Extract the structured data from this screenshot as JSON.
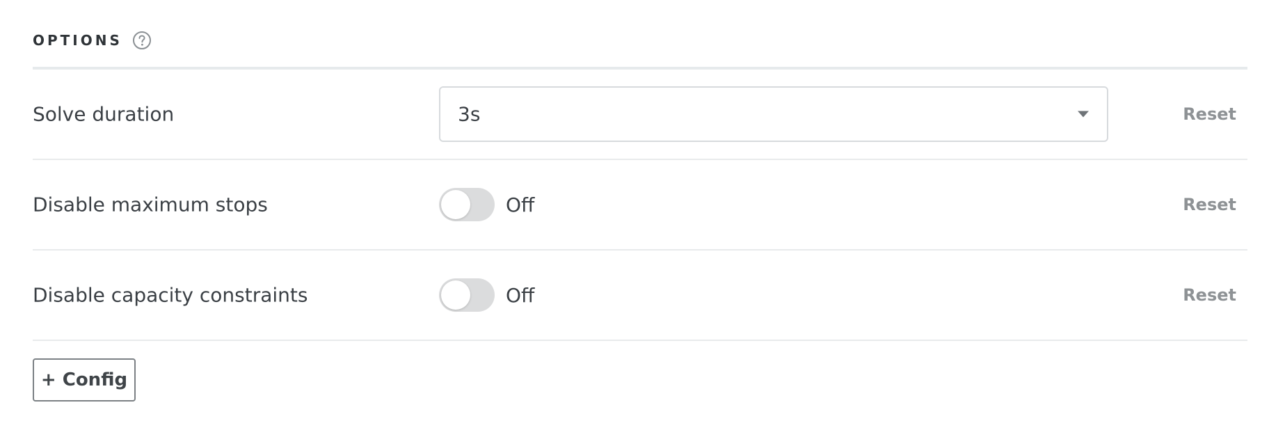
{
  "section": {
    "title": "OPTIONS",
    "help_icon": "question-circle-icon"
  },
  "options": {
    "solve_duration": {
      "label": "Solve duration",
      "value": "3s",
      "reset_label": "Reset"
    },
    "disable_maximum_stops": {
      "label": "Disable maximum stops",
      "state_label": "Off",
      "enabled": false,
      "reset_label": "Reset"
    },
    "disable_capacity_constraints": {
      "label": "Disable capacity constraints",
      "state_label": "Off",
      "enabled": false,
      "reset_label": "Reset"
    }
  },
  "actions": {
    "add_config_label": "+ Config"
  },
  "colors": {
    "toggle_off": "#dbdcdd",
    "reset_text": "#8e9295",
    "divider": "#e8eaec"
  }
}
